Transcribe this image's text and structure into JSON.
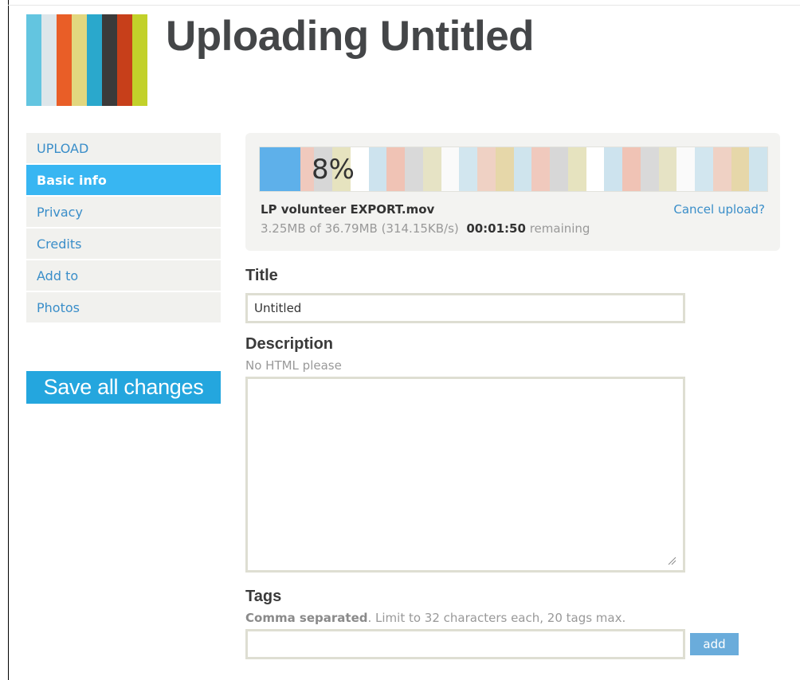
{
  "page": {
    "title": "Uploading Untitled",
    "logo_colors": [
      "#63c5e0",
      "#dde6ea",
      "#e95e27",
      "#e2d77f",
      "#2aa8cc",
      "#3b3a3a",
      "#c73f1a",
      "#c2d12a"
    ]
  },
  "sidebar": {
    "items": [
      {
        "label": "UPLOAD",
        "active": false
      },
      {
        "label": "Basic info",
        "active": true
      },
      {
        "label": "Privacy",
        "active": false
      },
      {
        "label": "Credits",
        "active": false
      },
      {
        "label": "Add to",
        "active": false
      },
      {
        "label": "Photos",
        "active": false
      }
    ],
    "save_label": "Save all changes"
  },
  "upload": {
    "percent_label": "8%",
    "percent": 8,
    "file_name": "LP volunteer EXPORT.mov",
    "cancel_label": "Cancel upload?",
    "progress_text": "3.25MB of 36.79MB (314.15KB/s)",
    "time_remaining": "00:01:50",
    "remaining_label": "remaining",
    "stripe_colors": [
      "#e6d7a9",
      "#cfe4ed",
      "#f0c9bd",
      "#d7d7d7",
      "#e6e3bf",
      "#ffffff",
      "#cde3ee",
      "#f0c3b5",
      "#d9d9d9",
      "#e6e3c5",
      "#fafafa",
      "#d2e6ef",
      "#efd1c4"
    ]
  },
  "form": {
    "title_label": "Title",
    "title_value": "Untitled",
    "description_label": "Description",
    "description_hint": "No HTML please",
    "description_value": "",
    "tags_label": "Tags",
    "tags_hint_bold": "Comma separated",
    "tags_hint_rest": ". Limit to 32 characters each, 20 tags max.",
    "tags_value": "",
    "add_label": "add"
  },
  "colors": {
    "accent": "#38b6f2",
    "link": "#3a8ec9",
    "field_border": "#deded2",
    "progress_fill": "#5eb0ea"
  }
}
